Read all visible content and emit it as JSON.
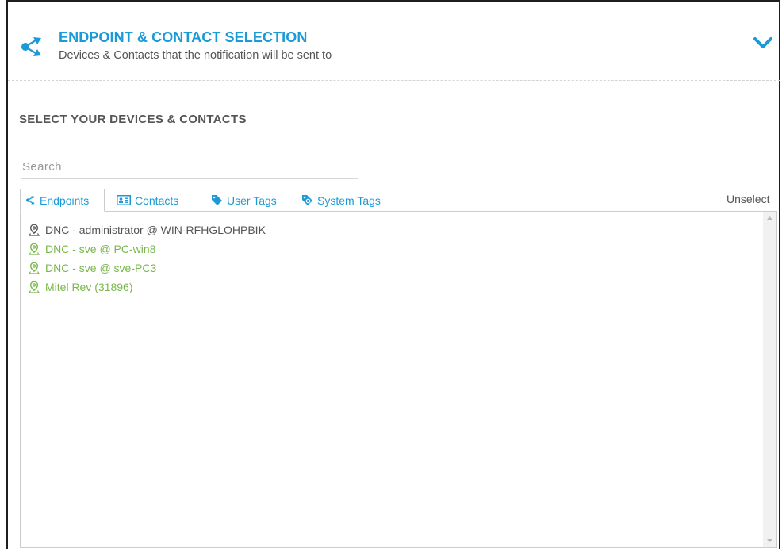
{
  "header": {
    "title": "ENDPOINT & CONTACT SELECTION",
    "subtitle": "Devices & Contacts that the notification will be sent to",
    "icon": "endpoint-share-icon",
    "collapse_icon": "chevron-down-icon",
    "accent_color": "#1a9ad6"
  },
  "section": {
    "title": "SELECT YOUR DEVICES & CONTACTS"
  },
  "search": {
    "placeholder": "Search",
    "value": ""
  },
  "tabs": [
    {
      "label": "Endpoints",
      "icon": "endpoint-share-icon",
      "active": true
    },
    {
      "label": "Contacts",
      "icon": "contact-card-icon",
      "active": false
    },
    {
      "label": "User Tags",
      "icon": "tag-icon",
      "active": false
    },
    {
      "label": "System Tags",
      "icon": "system-tag-icon",
      "active": false
    }
  ],
  "unselect_label": "Unselect",
  "endpoints": [
    {
      "label": "DNC - administrator @ WIN-RFHGLOHPBIK",
      "status_color": "#555555",
      "icon": "location-pin-icon"
    },
    {
      "label": "DNC - sve @ PC-win8",
      "status_color": "#78b84a",
      "icon": "location-pin-icon"
    },
    {
      "label": "DNC - sve @ sve-PC3",
      "status_color": "#78b84a",
      "icon": "location-pin-icon"
    },
    {
      "label": "Mitel Rev (31896)",
      "status_color": "#78b84a",
      "icon": "location-pin-icon"
    }
  ]
}
